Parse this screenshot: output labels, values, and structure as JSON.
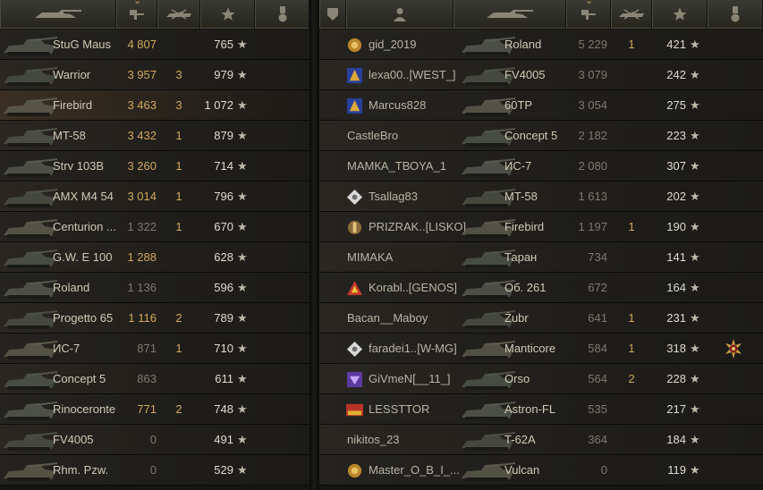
{
  "colors": {
    "accent": "#c5a058",
    "battles_hi": "#cfa95e",
    "battles_dim": "#7c7a6f"
  },
  "left": {
    "rows": [
      {
        "tank": "StuG Maus",
        "battles": "4 807",
        "medals": "",
        "rating": "765",
        "hi": true
      },
      {
        "tank": "Warrior",
        "battles": "3 957",
        "medals": "3",
        "rating": "979",
        "hi": true
      },
      {
        "tank": "Firebird",
        "battles": "3 463",
        "medals": "3",
        "rating": "1 072",
        "hi": true
      },
      {
        "tank": "MT-58",
        "battles": "3 432",
        "medals": "1",
        "rating": "879",
        "hi": true
      },
      {
        "tank": "Strv 103B",
        "battles": "3 260",
        "medals": "1",
        "rating": "714",
        "hi": true
      },
      {
        "tank": "AMX M4 54",
        "battles": "3 014",
        "medals": "1",
        "rating": "796",
        "hi": true
      },
      {
        "tank": "Centurion ...",
        "battles": "1 322",
        "medals": "1",
        "rating": "670",
        "hi": false
      },
      {
        "tank": "G.W. E 100",
        "battles": "1 288",
        "medals": "",
        "rating": "628",
        "hi": true
      },
      {
        "tank": "Roland",
        "battles": "1 136",
        "medals": "",
        "rating": "596",
        "hi": false
      },
      {
        "tank": "Progetto 65",
        "battles": "1 116",
        "medals": "2",
        "rating": "789",
        "hi": true
      },
      {
        "tank": "ИС-7",
        "battles": "871",
        "medals": "1",
        "rating": "710",
        "hi": false
      },
      {
        "tank": "Concept 5",
        "battles": "863",
        "medals": "",
        "rating": "611",
        "hi": false
      },
      {
        "tank": "Rinoceronte",
        "battles": "771",
        "medals": "2",
        "rating": "748",
        "hi": true
      },
      {
        "tank": "FV4005",
        "battles": "0",
        "medals": "",
        "rating": "491",
        "hi": false
      },
      {
        "tank": "Rhm. Pzw.",
        "battles": "0",
        "medals": "",
        "rating": "529",
        "hi": false
      }
    ]
  },
  "right": {
    "rows": [
      {
        "player": "gid_2019",
        "clan": "gold",
        "tank": "Roland",
        "battles": "5 229",
        "medals": "1",
        "rating": "421",
        "award": ""
      },
      {
        "player": "lexa00..[WEST_]",
        "clan": "blue",
        "tank": "FV4005",
        "battles": "3 079",
        "medals": "",
        "rating": "242",
        "award": ""
      },
      {
        "player": "Marcus828",
        "clan": "blue",
        "tank": "60TP",
        "battles": "3 054",
        "medals": "",
        "rating": "275",
        "award": ""
      },
      {
        "player": "CastleBro",
        "clan": "",
        "tank": "Concept 5",
        "battles": "2 182",
        "medals": "",
        "rating": "223",
        "award": ""
      },
      {
        "player": "МАМКА_ТВОYA_1",
        "clan": "",
        "tank": "ИС-7",
        "battles": "2 080",
        "medals": "",
        "rating": "307",
        "award": ""
      },
      {
        "player": "Tsallag83",
        "clan": "white",
        "tank": "MT-58",
        "battles": "1 613",
        "medals": "",
        "rating": "202",
        "award": ""
      },
      {
        "player": "PRIZRAK..[LISKO]",
        "clan": "bronze",
        "tank": "Firebird",
        "battles": "1 197",
        "medals": "1",
        "rating": "190",
        "award": ""
      },
      {
        "player": "MIMAKA",
        "clan": "",
        "tank": "Таран",
        "battles": "734",
        "medals": "",
        "rating": "141",
        "award": ""
      },
      {
        "player": "Korabl..[GENOS]",
        "clan": "red",
        "tank": "Об. 261",
        "battles": "672",
        "medals": "",
        "rating": "164",
        "award": ""
      },
      {
        "player": "Bacan__Maboy",
        "clan": "",
        "tank": "Żubr",
        "battles": "641",
        "medals": "1",
        "rating": "231",
        "award": ""
      },
      {
        "player": "faradei1..[W-MG]",
        "clan": "white",
        "tank": "Manticore",
        "battles": "584",
        "medals": "1",
        "rating": "318",
        "award": "medal"
      },
      {
        "player": "GiVmeN[__11_]",
        "clan": "purple",
        "tank": "Orso",
        "battles": "564",
        "medals": "2",
        "rating": "228",
        "award": ""
      },
      {
        "player": "LESSTTOR",
        "clan": "lesta",
        "tank": "Astron-FL",
        "battles": "535",
        "medals": "",
        "rating": "217",
        "award": ""
      },
      {
        "player": "nikitos_23",
        "clan": "",
        "tank": "T-62A",
        "battles": "364",
        "medals": "",
        "rating": "184",
        "award": ""
      },
      {
        "player": "Master_O_B_I_...",
        "clan": "gold",
        "tank": "Vulcan",
        "battles": "0",
        "medals": "",
        "rating": "119",
        "award": ""
      }
    ]
  }
}
